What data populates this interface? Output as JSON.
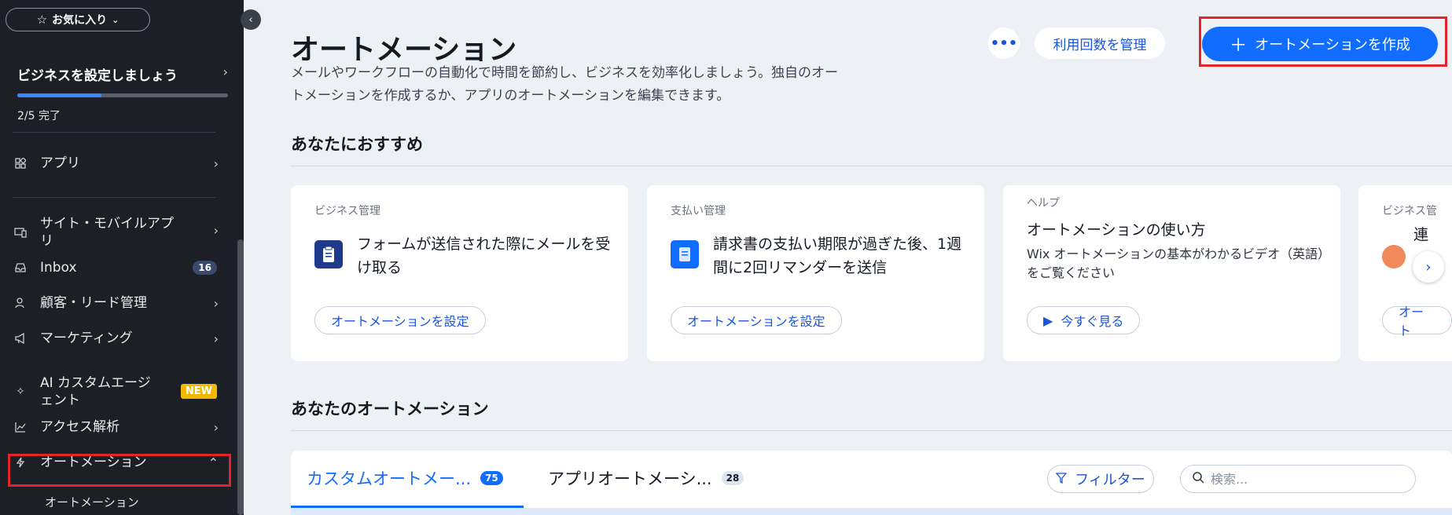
{
  "sidebar": {
    "favorites_label": "お気に入り",
    "setup_title": "ビジネスを設定しましょう",
    "setup_progress": 0.4,
    "setup_progress_text": "2/5 完了",
    "items": [
      {
        "label": "アプリ"
      },
      {
        "label": "サイト・モバイルアプリ"
      },
      {
        "label": "Inbox",
        "count": "16"
      },
      {
        "label": "顧客・リード管理"
      },
      {
        "label": "マーケティング"
      },
      {
        "label": "AI カスタムエージェント",
        "badge": "NEW"
      },
      {
        "label": "アクセス解析"
      },
      {
        "label": "オートメーション"
      }
    ],
    "sub_item": "オートメーション"
  },
  "header": {
    "title": "オートメーション",
    "description": "メールやワークフローの自動化で時間を節約し、ビジネスを効率化しましょう。独自のオートメーションを作成するか、アプリのオートメーションを編集できます。",
    "more_label": "•••",
    "usage_label": "利用回数を管理",
    "create_label": "オートメーションを作成"
  },
  "recommended": {
    "title": "あなたにおすすめ",
    "cards": [
      {
        "category": "ビジネス管理",
        "title": "フォームが送信された際にメールを受け取る",
        "action": "オートメーションを設定"
      },
      {
        "category": "支払い管理",
        "title": "請求書の支払い期限が過ぎた後、1週間に2回リマンダーを送信",
        "action": "オートメーションを設定"
      },
      {
        "category": "ヘルプ",
        "title": "オートメーションの使い方",
        "desc": "Wix オートメーションの基本がわかるビデオ（英語）をご覧ください",
        "action": "今すぐ見る"
      },
      {
        "category": "ビジネス管",
        "title": "連",
        "action": "オート"
      }
    ]
  },
  "yours": {
    "title": "あなたのオートメーション",
    "tabs": [
      {
        "label": "カスタムオートメー...",
        "count": "75"
      },
      {
        "label": "アプリオートメーシ...",
        "count": "28"
      }
    ],
    "filter_label": "フィルター",
    "search_placeholder": "検索..."
  },
  "colors": {
    "accent": "#116dff",
    "highlight": "#e1262b",
    "sidebar_bg": "#1c2026"
  }
}
